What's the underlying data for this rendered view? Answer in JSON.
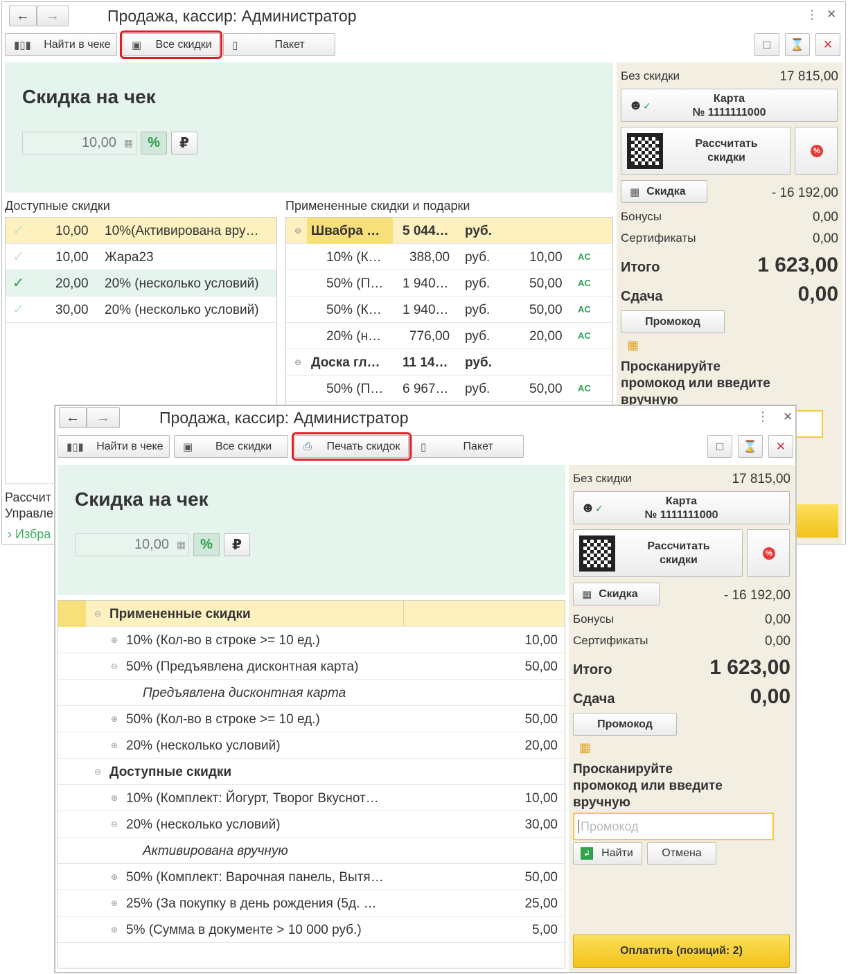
{
  "title": "Продажа, кассир: Администратор",
  "toolbar": {
    "find_in_check": "Найти в чеке",
    "all_discounts": "Все скидки",
    "print_discounts": "Печать скидок",
    "package": "Пакет"
  },
  "discount": {
    "title": "Скидка на чек",
    "value": "10,00",
    "pct": "%",
    "rub": "₽"
  },
  "available": {
    "label": "Доступные скидки",
    "rows": [
      {
        "value": "10,00",
        "name": "10%(Активирована вру…",
        "checked": "light"
      },
      {
        "value": "10,00",
        "name": "Жара23",
        "checked": "light"
      },
      {
        "value": "20,00",
        "name": "20% (несколько условий)",
        "checked": "strong"
      },
      {
        "value": "30,00",
        "name": "20% (несколько условий)",
        "checked": "light"
      }
    ]
  },
  "applied": {
    "label": "Примененные скидки и подарки",
    "rows": [
      {
        "name": "Швабра …",
        "sum": "5 044…",
        "cur": "руб.",
        "pct": "",
        "ac": "",
        "group": true
      },
      {
        "name": "10% (К…",
        "sum": "388,00",
        "cur": "руб.",
        "pct": "10,00",
        "ac": "AC",
        "group": false
      },
      {
        "name": "50% (П…",
        "sum": "1 940…",
        "cur": "руб.",
        "pct": "50,00",
        "ac": "AC",
        "group": false
      },
      {
        "name": "50% (К…",
        "sum": "1 940…",
        "cur": "руб.",
        "pct": "50,00",
        "ac": "AC",
        "group": false
      },
      {
        "name": "20% (н…",
        "sum": "776,00",
        "cur": "руб.",
        "pct": "20,00",
        "ac": "AC",
        "group": false
      },
      {
        "name": "Доска гл…",
        "sum": "11 14…",
        "cur": "руб.",
        "pct": "",
        "ac": "",
        "group": true
      },
      {
        "name": "50% (П…",
        "sum": "6 967…",
        "cur": "руб.",
        "pct": "50,00",
        "ac": "AC",
        "group": false
      }
    ]
  },
  "win1_bottom": {
    "line1": "Рассчит",
    "line2": "Управле",
    "line3": "Избра"
  },
  "panel": {
    "no_discount_label": "Без скидки",
    "no_discount_value": "17 815,00",
    "card_label": "Карта",
    "card_number": "№ 1111111000",
    "calc_label_1": "Рассчитать",
    "calc_label_2": "скидки",
    "discount_btn": "Скидка",
    "discount_value": "- 16 192,00",
    "bonus_label": "Бонусы",
    "bonus_value": "0,00",
    "cert_label": "Сертификаты",
    "cert_value": "0,00",
    "total_label": "Итого",
    "total_value": "1 623,00",
    "change_label": "Сдача",
    "change_value": "0,00",
    "promo_btn": "Промокод",
    "prompt_1": "Просканируйте",
    "prompt_2": "промокод или введите",
    "prompt_3": "вручную",
    "promo_placeholder": "Промокод",
    "find_btn": "Найти",
    "cancel_btn": "Отмена",
    "pay_btn": "Оплатить (позиций: 2)"
  },
  "tree": {
    "rows": [
      {
        "level": 0,
        "icon": "⊖",
        "text": "Примененные скидки",
        "value": "",
        "italic": false,
        "bold": true
      },
      {
        "level": 1,
        "icon": "⊕",
        "text": "10% (Кол-во в строке >= 10 ед.)",
        "value": "10,00",
        "italic": false,
        "bold": false
      },
      {
        "level": 1,
        "icon": "⊖",
        "text": "50% (Предъявлена дисконтная карта)",
        "value": "50,00",
        "italic": false,
        "bold": false
      },
      {
        "level": 2,
        "icon": "",
        "text": "Предъявлена дисконтная карта",
        "value": "",
        "italic": true,
        "bold": false
      },
      {
        "level": 1,
        "icon": "⊕",
        "text": "50% (Кол-во в строке >= 10 ед.)",
        "value": "50,00",
        "italic": false,
        "bold": false
      },
      {
        "level": 1,
        "icon": "⊕",
        "text": "20% (несколько условий)",
        "value": "20,00",
        "italic": false,
        "bold": false
      },
      {
        "level": 0,
        "icon": "⊖",
        "text": "Доступные скидки",
        "value": "",
        "italic": false,
        "bold": true
      },
      {
        "level": 1,
        "icon": "⊕",
        "text": "10% (Комплект: Йогурт, Творог Вкуснот…",
        "value": "10,00",
        "italic": false,
        "bold": false
      },
      {
        "level": 1,
        "icon": "⊖",
        "text": "20% (несколько условий)",
        "value": "30,00",
        "italic": false,
        "bold": false
      },
      {
        "level": 2,
        "icon": "",
        "text": "Активирована вручную",
        "value": "",
        "italic": true,
        "bold": false
      },
      {
        "level": 1,
        "icon": "⊕",
        "text": "50% (Комплект: Варочная панель, Вытя…",
        "value": "50,00",
        "italic": false,
        "bold": false
      },
      {
        "level": 1,
        "icon": "⊕",
        "text": "25% (За покупку в день рождения (5д. …",
        "value": "25,00",
        "italic": false,
        "bold": false
      },
      {
        "level": 1,
        "icon": "⊕",
        "text": "5% (Сумма в документе > 10 000 руб.)",
        "value": "5,00",
        "italic": false,
        "bold": false
      }
    ]
  },
  "colors": {
    "highlight": "#e21d25",
    "green_panel": "#e5f4ed",
    "right_panel": "#f2eee2",
    "selected_row": "#fdf1bf",
    "pay": "#f2c21a"
  }
}
